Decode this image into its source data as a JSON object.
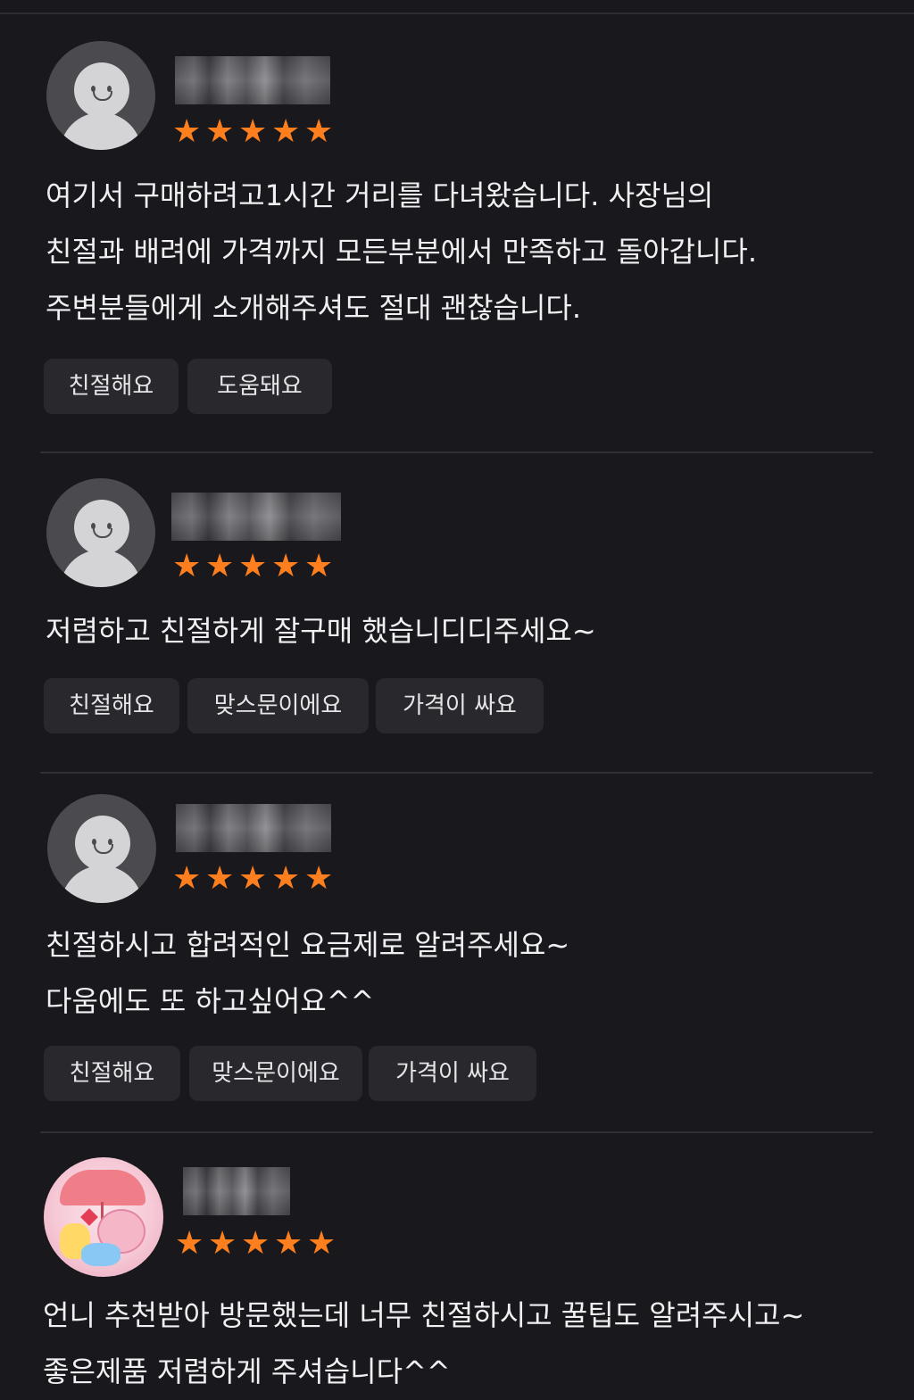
{
  "reviews": [
    {
      "rating": 5,
      "stars": "★★★★★",
      "text_lines": [
        "여기서 구매하려고1시간 거리를 다녀왔습니다. 사장님의",
        "친절과 배려에 가격까지 모든부분에서 만족하고 돌아갑니다.",
        "주변분들에게 소개해주셔도 절대 괜찮습니다."
      ],
      "tags": [
        "친절해요",
        "도움돼요"
      ]
    },
    {
      "rating": 5,
      "stars": "★★★★★",
      "text_lines": [
        "저렴하고 친절하게 잘구매 했습니디디주세요~"
      ],
      "tags": [
        "친절해요",
        "맞스문이에요",
        "가격이 싸요"
      ]
    },
    {
      "rating": 5,
      "stars": "★★★★★",
      "text_lines": [
        "친절하시고 합려적인 요금제로 알려주세요~",
        "다움에도 또 하고싶어요^^"
      ],
      "tags": [
        "친절해요",
        "맞스문이에요",
        "가격이 싸요"
      ]
    },
    {
      "rating": 5,
      "stars": "★★★★★",
      "text_lines": [
        "언니 추천받아 방문했는데 너무 친절하시고 꿀팁도 알려주시고~",
        "좋은제품 저렴하게 주셔습니다^^"
      ],
      "tags": []
    }
  ],
  "icons": {
    "default_avatar": "person-silhouette-icon",
    "star": "star-icon"
  },
  "colors": {
    "background": "#19191d",
    "star": "#ff7e1d",
    "tag_bg": "#28282d",
    "divider": "#2f2f34"
  }
}
